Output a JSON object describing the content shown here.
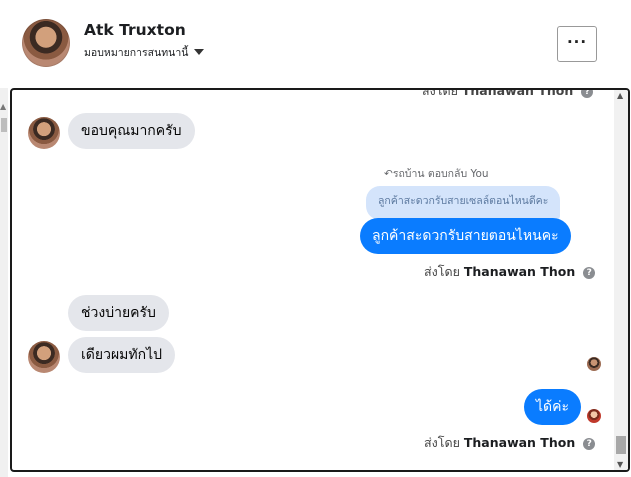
{
  "header": {
    "name": "Atk Truxton",
    "subtitle": "มอบหมายการสนทนานี้",
    "more_label": "···"
  },
  "messages": {
    "top_cut_sent_by_prefix": "ส่งโดย",
    "top_cut_sender": "Thanawan Thon",
    "m1": "ขอบคุณมากครับ",
    "reply_label": "รถบ้าน ตอบกลับ You",
    "reply_quote": "ลูกค้าสะดวกรับสายเซลล์ตอนไหนดีคะ",
    "m2": "ลูกค้าสะดวกรับสายตอนไหนคะ",
    "sent_by_prefix": "ส่งโดย",
    "sender": "Thanawan Thon",
    "m3": "ช่วงบ่ายครับ",
    "m4": "เดียวผมทักไป",
    "m5": "ได้ค่ะ",
    "help_glyph": "?"
  },
  "icons": {
    "more": "ellipsis-icon",
    "help": "question-circle-icon",
    "reply": "reply-arrow-icon"
  },
  "colors": {
    "outgoing_bubble": "#0a7cff",
    "incoming_bubble": "#e4e6eb",
    "reply_quote_bg": "#d4e4fb"
  }
}
